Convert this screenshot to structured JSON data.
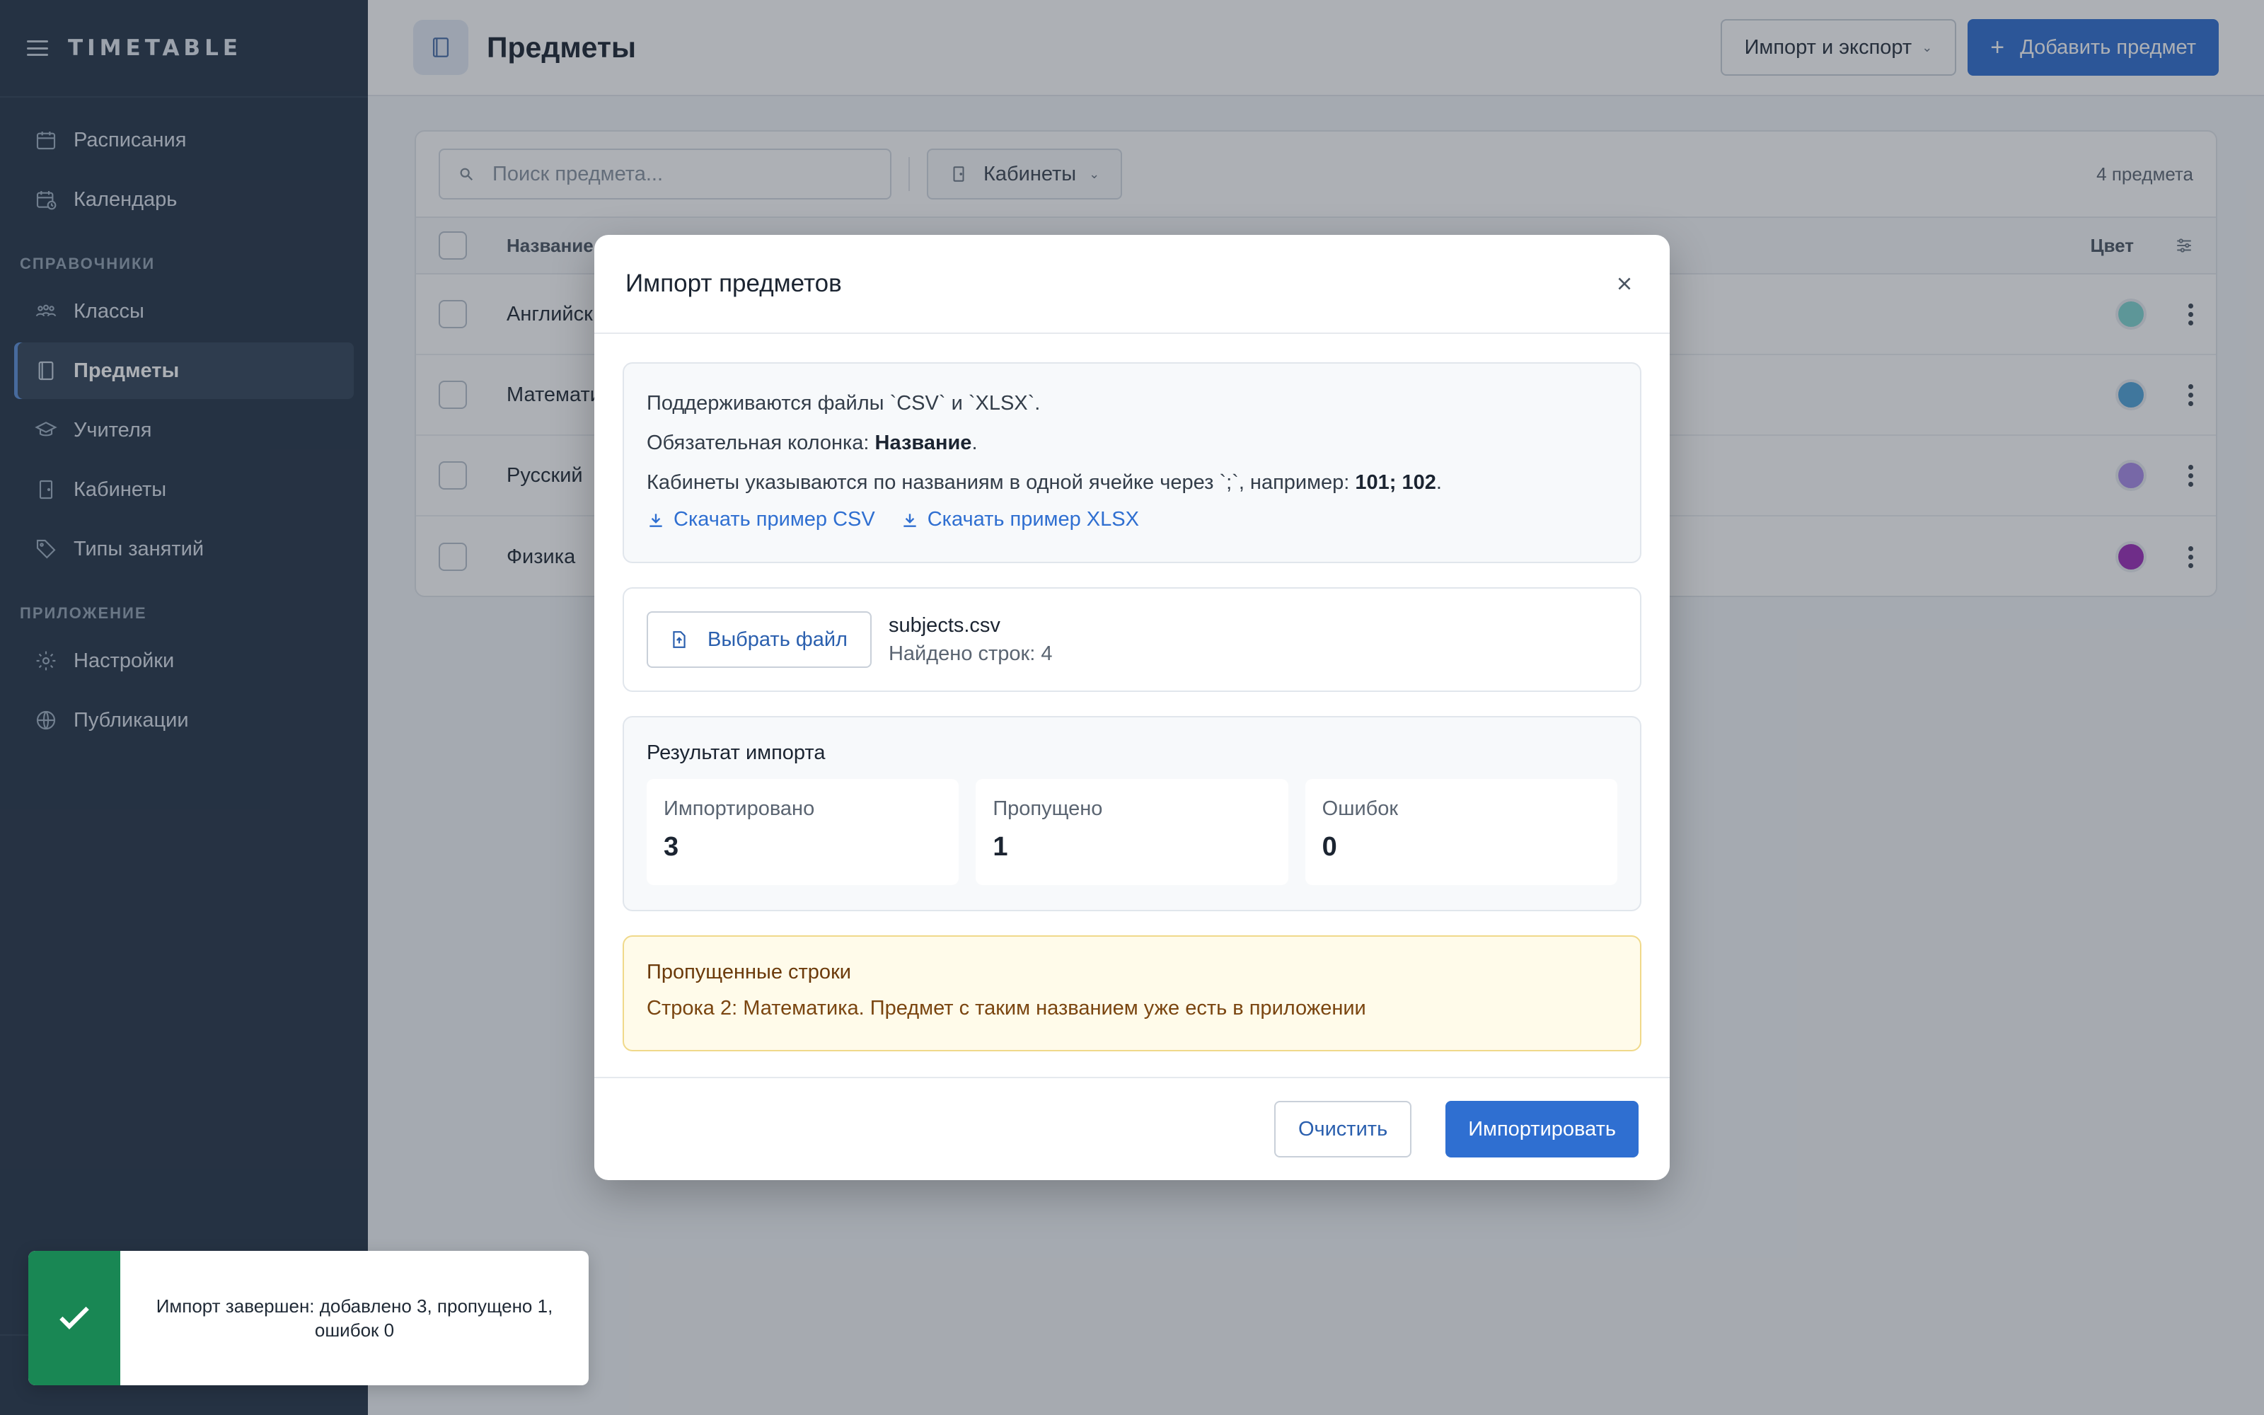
{
  "app": {
    "brand": "TIMETABLE"
  },
  "sidebar": {
    "items_top": [
      {
        "label": "Расписания",
        "icon": "calendar-icon"
      },
      {
        "label": "Календарь",
        "icon": "calendar-clock-icon"
      }
    ],
    "section_refs": "СПРАВОЧНИКИ",
    "items_refs": [
      {
        "label": "Классы",
        "icon": "users-icon"
      },
      {
        "label": "Предметы",
        "icon": "book-icon",
        "active": true
      },
      {
        "label": "Учителя",
        "icon": "graduation-cap-icon"
      },
      {
        "label": "Кабинеты",
        "icon": "door-icon"
      },
      {
        "label": "Типы занятий",
        "icon": "tag-icon"
      }
    ],
    "section_app": "ПРИЛОЖЕНИЕ",
    "items_app": [
      {
        "label": "Настройки",
        "icon": "gear-icon"
      },
      {
        "label": "Публикации",
        "icon": "globe-icon"
      }
    ]
  },
  "header": {
    "title": "Предметы",
    "import_export_label": "Импорт и экспорт",
    "add_label": "Добавить предмет"
  },
  "toolbar": {
    "search_placeholder": "Поиск предмета...",
    "filter_label": "Кабинеты",
    "count": "4 предмета"
  },
  "table": {
    "col_name": "Название",
    "col_color": "Цвет",
    "rows": [
      {
        "name": "Английск",
        "color": "#7fd6d0"
      },
      {
        "name": "Математи",
        "color": "#4fa3d9"
      },
      {
        "name": "Русский",
        "color": "#a98be8"
      },
      {
        "name": "Физика",
        "color": "#9b2db8"
      }
    ]
  },
  "modal": {
    "title": "Импорт предметов",
    "info_line1": "Поддерживаются файлы `CSV` и `XLSX`.",
    "info_line2_prefix": "Обязательная колонка: ",
    "info_line2_bold": "Название",
    "info_line2_suffix": ".",
    "info_line3_prefix": "Кабинеты указываются по названиям в одной ячейке через `;`, например: ",
    "info_line3_bold": "101; 102",
    "info_line3_suffix": ".",
    "download_csv": "Скачать пример CSV",
    "download_xlsx": "Скачать пример XLSX",
    "choose_file": "Выбрать файл",
    "file_name": "subjects.csv",
    "rows_found": "Найдено строк: 4",
    "result_title": "Результат импорта",
    "stats": [
      {
        "label": "Импортировано",
        "value": "3"
      },
      {
        "label": "Пропущено",
        "value": "1"
      },
      {
        "label": "Ошибок",
        "value": "0"
      }
    ],
    "skipped_title": "Пропущенные строки",
    "skipped_text": "Строка 2: Математика. Предмет с таким названием уже есть в приложении",
    "clear_label": "Очистить",
    "import_label": "Импортировать"
  },
  "toast": {
    "text": "Импорт завершен: добавлено 3, пропущено 1, ошибок 0",
    "accent": "#198754"
  },
  "colors": {
    "primary": "#2f6fd1",
    "sidebar_bg": "#243447"
  }
}
